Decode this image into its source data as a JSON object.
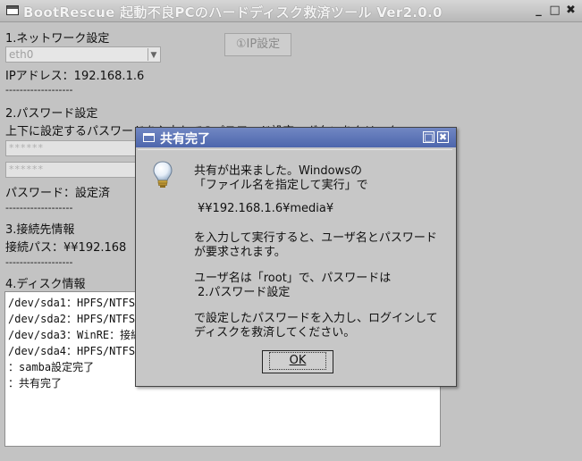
{
  "window": {
    "title": "BootRescue 起動不良PCのハードディスク救済ツール Ver2.0.0",
    "minimize": "_",
    "maximize": "□",
    "close": "✖"
  },
  "network": {
    "heading": "1.ネットワーク設定",
    "interface_value": "eth0",
    "ip_button": "①IP設定",
    "ip_label": "IPアドレス：192.168.1.6",
    "separator": "-------------------"
  },
  "password": {
    "heading": "2.パスワード設定",
    "instruction": "上下に設定するパスワードを入力して②パスワード設定」ボタンをクリック",
    "field1": "******",
    "field2": "******",
    "status": "パスワード：設定済",
    "separator": "-------------------"
  },
  "connection": {
    "heading": "3.接続先情報",
    "path": "接続パス：¥¥192.168",
    "separator": "-------------------"
  },
  "disk": {
    "heading": "4.ディスク情報",
    "lines": [
      "/dev/sda1：HPFS/NTFS/",
      "/dev/sda2：HPFS/NTFS/",
      "/dev/sda3：WinRE：接続",
      "/dev/sda4：HPFS/NTFS/",
      "：samba設定完了",
      "：共有完了"
    ]
  },
  "dialog": {
    "title": "共有完了",
    "icon": "lightbulb-icon",
    "lines": [
      "共有が出来ました。Windowsの",
      "「ファイル名を指定して実行」で",
      "¥¥192.168.1.6¥media¥",
      "を入力して実行すると、ユーザ名とパスワード",
      "が要求されます。",
      "ユーザ名は「root」で、パスワードは",
      "2.パスワード設定",
      "で設定したパスワードを入力し、ログインして",
      "ディスクを救済してください。"
    ],
    "ok_label": "OK"
  }
}
